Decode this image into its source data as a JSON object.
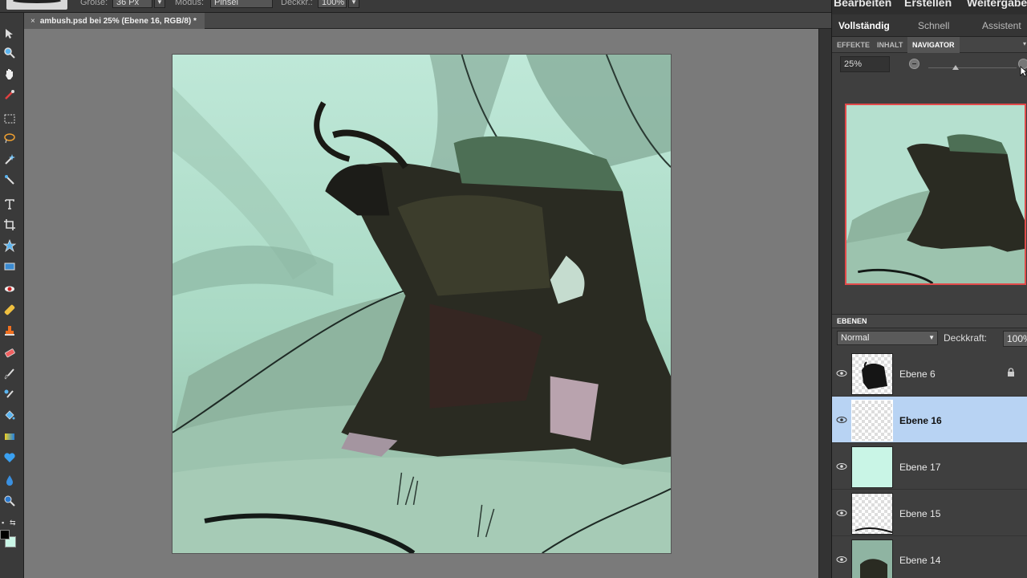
{
  "options_bar": {
    "size_label": "Größe:",
    "size_value": "36 Px",
    "mode_label": "Modus:",
    "mode_value": "Pinsel",
    "opacity_label": "Deckkr.:",
    "opacity_value": "100%"
  },
  "document_tab": {
    "close_symbol": "×",
    "title": "ambush.psd bei 25% (Ebene 16, RGB/8) *"
  },
  "top_menu": {
    "items": [
      "Bearbeiten",
      "Erstellen",
      "Weitergabe"
    ]
  },
  "workspace_tabs": {
    "items": [
      "Vollständig",
      "Schnell",
      "Assistent"
    ],
    "active": "Vollständig"
  },
  "panel_tabs": {
    "items": [
      "EFFEKTE",
      "INHALT",
      "NAVIGATOR"
    ],
    "active": "NAVIGATOR"
  },
  "navigator": {
    "zoom_value": "25%"
  },
  "layers_panel": {
    "title": "EBENEN",
    "blend_mode": "Normal",
    "opacity_label": "Deckkraft:",
    "opacity_value": "100%",
    "layers": [
      {
        "name": "Ebene 6",
        "locked": true,
        "selected": false
      },
      {
        "name": "Ebene 16",
        "locked": false,
        "selected": true
      },
      {
        "name": "Ebene 17",
        "locked": false,
        "selected": false
      },
      {
        "name": "Ebene 15",
        "locked": false,
        "selected": false
      },
      {
        "name": "Ebene 14",
        "locked": false,
        "selected": false
      }
    ]
  },
  "colors": {
    "foreground": "#000000",
    "background": "#c9f5e6",
    "selection": "#b8d3f3",
    "navigator_frame": "#e24a4a"
  },
  "icons": [
    "move-icon",
    "zoom-icon",
    "hand-icon",
    "eyedropper-icon",
    "marquee-icon",
    "lasso-icon",
    "magic-wand-icon",
    "selection-brush-icon",
    "type-icon",
    "crop-icon",
    "custom-shape-icon",
    "recompose-icon",
    "red-eye-icon",
    "spot-healing-icon",
    "clone-stamp-icon",
    "eraser-icon",
    "brush-icon",
    "smart-brush-icon",
    "paint-bucket-icon",
    "gradient-icon",
    "shape-icon",
    "blur-icon",
    "sponge-icon",
    "eye-icon",
    "lock-icon"
  ]
}
